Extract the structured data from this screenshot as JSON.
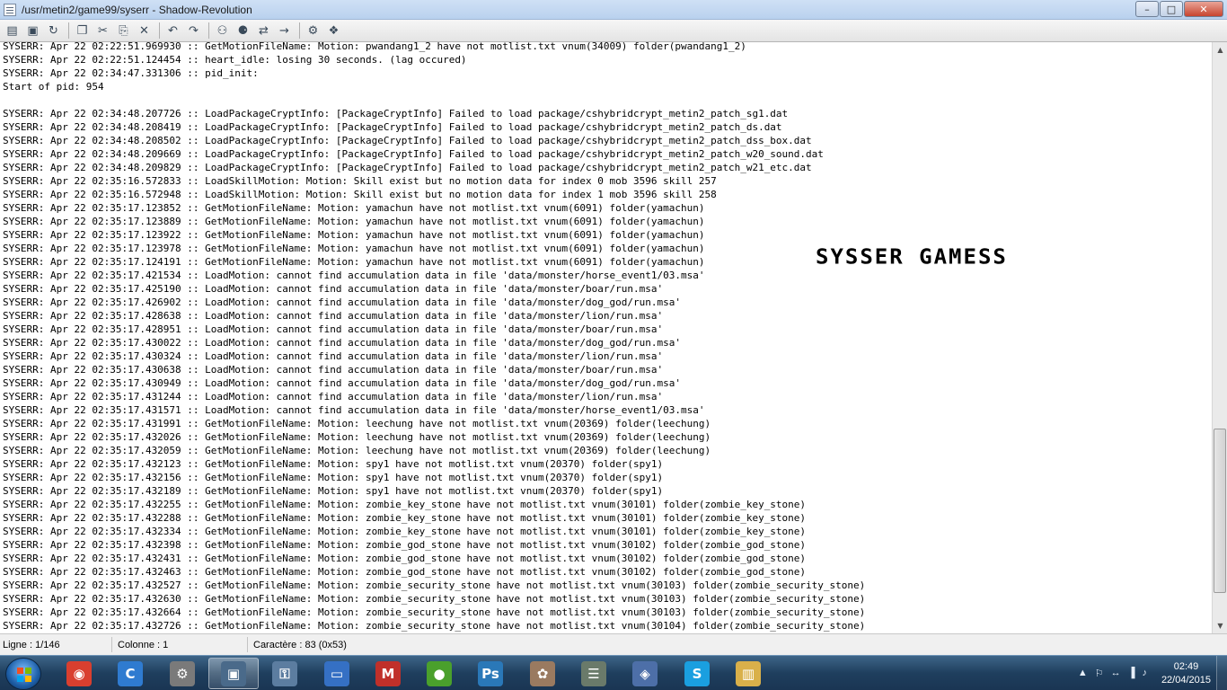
{
  "window": {
    "title": "/usr/metin2/game99/syserr - Shadow-Revolution"
  },
  "window_controls": {
    "minimize": "–",
    "maximize": "□",
    "close": "✕"
  },
  "toolbar": {
    "icons": [
      "new-file-icon",
      "save-icon",
      "reload-icon",
      "copy-icon",
      "cut-icon",
      "paste-icon",
      "delete-icon",
      "undo-icon",
      "redo-icon",
      "find-icon",
      "find-next-icon",
      "replace-icon",
      "go-to-icon",
      "settings-icon",
      "help-book-icon"
    ],
    "glyphs": [
      "▤",
      "▣",
      "↻",
      "❐",
      "✂",
      "⎘",
      "✕",
      "↶",
      "↷",
      "⚇",
      "⚈",
      "⇄",
      "→",
      "⚙",
      "❖"
    ]
  },
  "editor": {
    "lines": [
      "SYSERR: Apr 22 02:22:51.969930 :: GetMotionFileName: Motion: pwandang1_2 have not motlist.txt vnum(34009) folder(pwandang1_2)",
      "SYSERR: Apr 22 02:22:51.124454 :: heart_idle: losing 30 seconds. (lag occured)",
      "SYSERR: Apr 22 02:34:47.331306 :: pid_init:",
      "Start of pid: 954",
      "",
      "SYSERR: Apr 22 02:34:48.207726 :: LoadPackageCryptInfo: [PackageCryptInfo] Failed to load package/cshybridcrypt_metin2_patch_sg1.dat",
      "SYSERR: Apr 22 02:34:48.208419 :: LoadPackageCryptInfo: [PackageCryptInfo] Failed to load package/cshybridcrypt_metin2_patch_ds.dat",
      "SYSERR: Apr 22 02:34:48.208502 :: LoadPackageCryptInfo: [PackageCryptInfo] Failed to load package/cshybridcrypt_metin2_patch_dss_box.dat",
      "SYSERR: Apr 22 02:34:48.209669 :: LoadPackageCryptInfo: [PackageCryptInfo] Failed to load package/cshybridcrypt_metin2_patch_w20_sound.dat",
      "SYSERR: Apr 22 02:34:48.209829 :: LoadPackageCryptInfo: [PackageCryptInfo] Failed to load package/cshybridcrypt_metin2_patch_w21_etc.dat",
      "SYSERR: Apr 22 02:35:16.572833 :: LoadSkillMotion: Motion: Skill exist but no motion data for index 0 mob 3596 skill 257",
      "SYSERR: Apr 22 02:35:16.572948 :: LoadSkillMotion: Motion: Skill exist but no motion data for index 1 mob 3596 skill 258",
      "SYSERR: Apr 22 02:35:17.123852 :: GetMotionFileName: Motion: yamachun have not motlist.txt vnum(6091) folder(yamachun)",
      "SYSERR: Apr 22 02:35:17.123889 :: GetMotionFileName: Motion: yamachun have not motlist.txt vnum(6091) folder(yamachun)",
      "SYSERR: Apr 22 02:35:17.123922 :: GetMotionFileName: Motion: yamachun have not motlist.txt vnum(6091) folder(yamachun)",
      "SYSERR: Apr 22 02:35:17.123978 :: GetMotionFileName: Motion: yamachun have not motlist.txt vnum(6091) folder(yamachun)",
      "SYSERR: Apr 22 02:35:17.124191 :: GetMotionFileName: Motion: yamachun have not motlist.txt vnum(6091) folder(yamachun)",
      "SYSERR: Apr 22 02:35:17.421534 :: LoadMotion: cannot find accumulation data in file 'data/monster/horse_event1/03.msa'",
      "SYSERR: Apr 22 02:35:17.425190 :: LoadMotion: cannot find accumulation data in file 'data/monster/boar/run.msa'",
      "SYSERR: Apr 22 02:35:17.426902 :: LoadMotion: cannot find accumulation data in file 'data/monster/dog_god/run.msa'",
      "SYSERR: Apr 22 02:35:17.428638 :: LoadMotion: cannot find accumulation data in file 'data/monster/lion/run.msa'",
      "SYSERR: Apr 22 02:35:17.428951 :: LoadMotion: cannot find accumulation data in file 'data/monster/boar/run.msa'",
      "SYSERR: Apr 22 02:35:17.430022 :: LoadMotion: cannot find accumulation data in file 'data/monster/dog_god/run.msa'",
      "SYSERR: Apr 22 02:35:17.430324 :: LoadMotion: cannot find accumulation data in file 'data/monster/lion/run.msa'",
      "SYSERR: Apr 22 02:35:17.430638 :: LoadMotion: cannot find accumulation data in file 'data/monster/boar/run.msa'",
      "SYSERR: Apr 22 02:35:17.430949 :: LoadMotion: cannot find accumulation data in file 'data/monster/dog_god/run.msa'",
      "SYSERR: Apr 22 02:35:17.431244 :: LoadMotion: cannot find accumulation data in file 'data/monster/lion/run.msa'",
      "SYSERR: Apr 22 02:35:17.431571 :: LoadMotion: cannot find accumulation data in file 'data/monster/horse_event1/03.msa'",
      "SYSERR: Apr 22 02:35:17.431991 :: GetMotionFileName: Motion: leechung have not motlist.txt vnum(20369) folder(leechung)",
      "SYSERR: Apr 22 02:35:17.432026 :: GetMotionFileName: Motion: leechung have not motlist.txt vnum(20369) folder(leechung)",
      "SYSERR: Apr 22 02:35:17.432059 :: GetMotionFileName: Motion: leechung have not motlist.txt vnum(20369) folder(leechung)",
      "SYSERR: Apr 22 02:35:17.432123 :: GetMotionFileName: Motion: spy1 have not motlist.txt vnum(20370) folder(spy1)",
      "SYSERR: Apr 22 02:35:17.432156 :: GetMotionFileName: Motion: spy1 have not motlist.txt vnum(20370) folder(spy1)",
      "SYSERR: Apr 22 02:35:17.432189 :: GetMotionFileName: Motion: spy1 have not motlist.txt vnum(20370) folder(spy1)",
      "SYSERR: Apr 22 02:35:17.432255 :: GetMotionFileName: Motion: zombie_key_stone have not motlist.txt vnum(30101) folder(zombie_key_stone)",
      "SYSERR: Apr 22 02:35:17.432288 :: GetMotionFileName: Motion: zombie_key_stone have not motlist.txt vnum(30101) folder(zombie_key_stone)",
      "SYSERR: Apr 22 02:35:17.432334 :: GetMotionFileName: Motion: zombie_key_stone have not motlist.txt vnum(30101) folder(zombie_key_stone)",
      "SYSERR: Apr 22 02:35:17.432398 :: GetMotionFileName: Motion: zombie_god_stone have not motlist.txt vnum(30102) folder(zombie_god_stone)",
      "SYSERR: Apr 22 02:35:17.432431 :: GetMotionFileName: Motion: zombie_god_stone have not motlist.txt vnum(30102) folder(zombie_god_stone)",
      "SYSERR: Apr 22 02:35:17.432463 :: GetMotionFileName: Motion: zombie_god_stone have not motlist.txt vnum(30102) folder(zombie_god_stone)",
      "SYSERR: Apr 22 02:35:17.432527 :: GetMotionFileName: Motion: zombie_security_stone have not motlist.txt vnum(30103) folder(zombie_security_stone)",
      "SYSERR: Apr 22 02:35:17.432630 :: GetMotionFileName: Motion: zombie_security_stone have not motlist.txt vnum(30103) folder(zombie_security_stone)",
      "SYSERR: Apr 22 02:35:17.432664 :: GetMotionFileName: Motion: zombie_security_stone have not motlist.txt vnum(30103) folder(zombie_security_stone)",
      "SYSERR: Apr 22 02:35:17.432726 :: GetMotionFileName: Motion: zombie_security_stone have not motlist.txt vnum(30104) folder(zombie_security_stone)"
    ],
    "watermark": "SYSSER GAMESS"
  },
  "scrollbar": {
    "up_arrow": "▲",
    "down_arrow": "▼"
  },
  "statusbar": {
    "line": "Ligne : 1/146",
    "column": "Colonne : 1",
    "character": "Caractère : 83 (0x53)"
  },
  "taskbar": {
    "items": [
      {
        "name": "chrome",
        "icon": "chrome-icon",
        "glyph": "◉",
        "color": "#d93f2f"
      },
      {
        "name": "ccleaner",
        "icon": "ccleaner-icon",
        "glyph": "C",
        "color": "#2f7bd0"
      },
      {
        "name": "tool",
        "icon": "tool-icon",
        "glyph": "⚙",
        "color": "#7a7a7a"
      },
      {
        "name": "task-manager",
        "icon": "task-manager-icon",
        "glyph": "▣",
        "color": "#4a6a8a"
      },
      {
        "name": "network-lock",
        "icon": "network-lock-icon",
        "glyph": "⚿",
        "color": "#5c7da0"
      },
      {
        "name": "window",
        "icon": "window-icon",
        "glyph": "▭",
        "color": "#3570c4"
      },
      {
        "name": "metin2",
        "icon": "metin2-icon",
        "glyph": "M",
        "color": "#c0302a"
      },
      {
        "name": "frog",
        "icon": "frog-icon",
        "glyph": "●",
        "color": "#4aa02c"
      },
      {
        "name": "photoshop",
        "icon": "photoshop-icon",
        "glyph": "Ps",
        "color": "#2a78b8"
      },
      {
        "name": "gimp",
        "icon": "gimp-icon",
        "glyph": "✿",
        "color": "#9a7a60"
      },
      {
        "name": "notepad",
        "icon": "notepad-icon",
        "glyph": "☰",
        "color": "#6a7a6a"
      },
      {
        "name": "virtualbox",
        "icon": "virtualbox-icon",
        "glyph": "◈",
        "color": "#4d6fa8"
      },
      {
        "name": "skype",
        "icon": "skype-icon",
        "glyph": "S",
        "color": "#1a9fe0"
      },
      {
        "name": "explorer",
        "icon": "folder-icon",
        "glyph": "▥",
        "color": "#d9b04a"
      }
    ],
    "tray_icons": [
      "▲",
      "⚐",
      "↔",
      "▐",
      "♪"
    ],
    "time": "02:49",
    "date": "22/04/2015"
  },
  "colors": {
    "titlebar": "#c6daf2",
    "taskbar": "#1f3f5e",
    "text": "#000000"
  }
}
